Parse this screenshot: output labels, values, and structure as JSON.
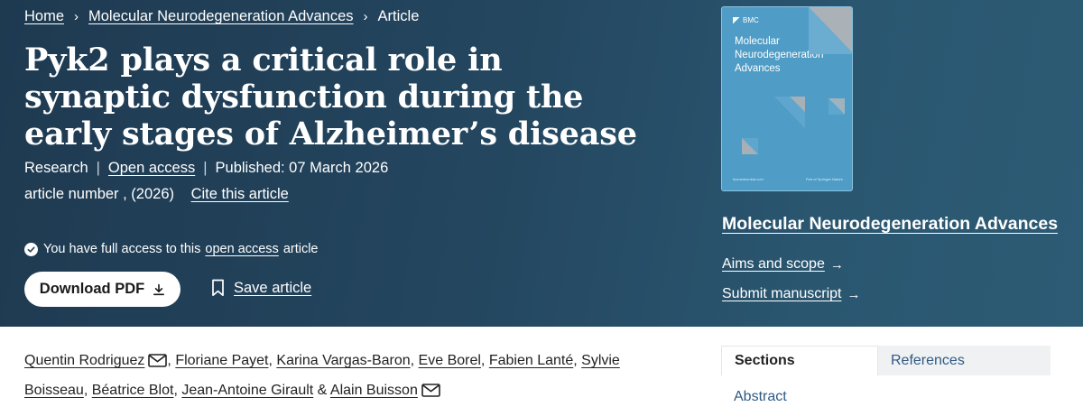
{
  "breadcrumb": {
    "home": "Home",
    "journal": "Molecular Neurodegeneration Advances",
    "current": "Article",
    "separator": "›"
  },
  "article": {
    "title": "Pyk2 plays a critical role in synaptic dysfunction during the early stages of Alzheimer’s disease",
    "type": "Research",
    "access": "Open access",
    "published": "Published: 07 March 2026",
    "article_number": "article number , (2026)",
    "cite": "Cite this article"
  },
  "access_notice": {
    "prefix": "You have full access to this",
    "link": "open access",
    "suffix": "article"
  },
  "actions": {
    "download": "Download PDF",
    "save": "Save article"
  },
  "cover": {
    "publisher": "BMC",
    "title": "Molecular Neurodegeneration Advances",
    "footer_left": "biomedcentral.com",
    "footer_right": "Part of Springer Nature",
    "color": "#4f9cc6"
  },
  "sidebar": {
    "journal_name": "Molecular Neurodegeneration Advances",
    "aims": "Aims and scope",
    "submit": "Submit manuscript"
  },
  "authors": [
    {
      "name": "Quentin Rodriguez",
      "email": true
    },
    {
      "name": "Floriane Payet",
      "email": false
    },
    {
      "name": "Karina Vargas-Baron",
      "email": false
    },
    {
      "name": "Eve Borel",
      "email": false
    },
    {
      "name": "Fabien Lanté",
      "email": false
    },
    {
      "name": "Sylvie Boisseau",
      "email": false
    },
    {
      "name": "Béatrice Blot",
      "email": false
    },
    {
      "name": "Jean-Antoine Girault",
      "email": false
    },
    {
      "name": "Alain Buisson",
      "email": true
    }
  ],
  "author_join": {
    "comma": ",",
    "amp": "&"
  },
  "tabs": {
    "sections": "Sections",
    "references": "References"
  },
  "nav": {
    "abstract": "Abstract"
  },
  "colors": {
    "hero_start": "#1e3a51",
    "hero_end": "#2d5b74",
    "link": "#2f5a85"
  }
}
